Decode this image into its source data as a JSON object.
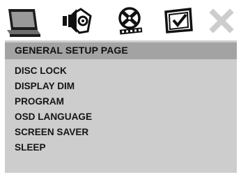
{
  "toolbar": {
    "icons": [
      {
        "name": "general-setup-icon"
      },
      {
        "name": "audio-setup-icon"
      },
      {
        "name": "video-setup-icon"
      },
      {
        "name": "preference-setup-icon"
      },
      {
        "name": "close-icon"
      }
    ]
  },
  "page": {
    "header": "GENERAL SETUP PAGE",
    "items": [
      {
        "label": "DISC LOCK"
      },
      {
        "label": "DISPLAY DIM"
      },
      {
        "label": "PROGRAM"
      },
      {
        "label": "OSD LANGUAGE"
      },
      {
        "label": "SCREEN SAVER"
      },
      {
        "label": "SLEEP"
      }
    ]
  },
  "colors": {
    "panel": "#cdcdcd",
    "header_bar": "#a3a3a3",
    "active_tab": "#7d7d7d"
  }
}
